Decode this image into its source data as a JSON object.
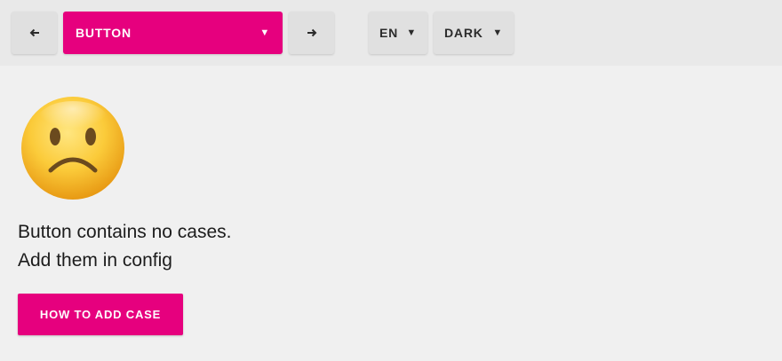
{
  "toolbar": {
    "prev_icon": "arrow-left-icon",
    "next_icon": "arrow-right-icon",
    "component_select": {
      "value": "BUTTON",
      "caret": "▼"
    },
    "language_select": {
      "value": "EN",
      "caret": "▼"
    },
    "theme_select": {
      "value": "DARK",
      "caret": "▼"
    }
  },
  "empty_state": {
    "icon": "sad-face-icon",
    "line1": "Button contains no cases.",
    "line2": "Add them in config",
    "cta_label": "HOW TO ADD CASE"
  },
  "colors": {
    "accent": "#e6007e",
    "background": "#f0f0f0",
    "toolbar_bg": "#e9e9e9"
  }
}
